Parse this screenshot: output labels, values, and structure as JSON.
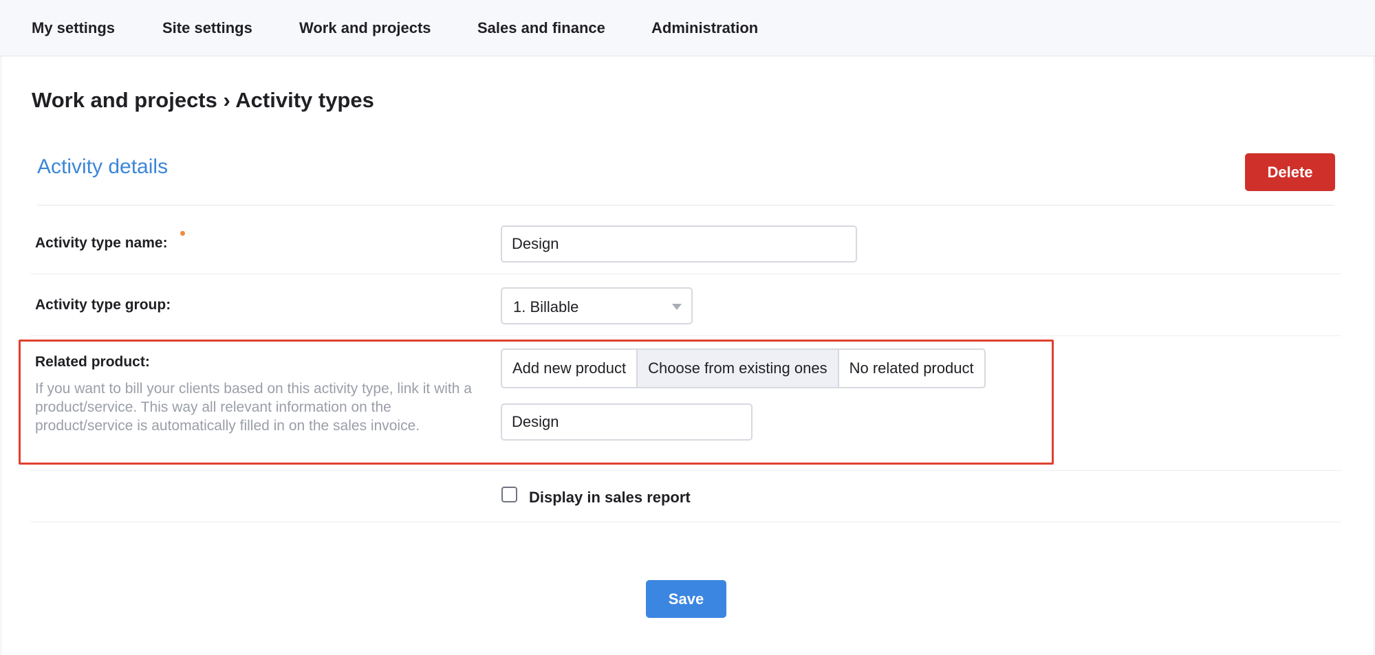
{
  "nav": {
    "items": [
      {
        "label": "My settings"
      },
      {
        "label": "Site settings"
      },
      {
        "label": "Work and projects"
      },
      {
        "label": "Sales and finance"
      },
      {
        "label": "Administration"
      }
    ]
  },
  "page": {
    "breadcrumb": "Work and projects › Activity types"
  },
  "section": {
    "title": "Activity details",
    "delete_label": "Delete"
  },
  "form": {
    "activity_type_name": {
      "label": "Activity type name:",
      "value": "Design"
    },
    "activity_type_group": {
      "label": "Activity type group:",
      "value": "1. Billable"
    },
    "related_product": {
      "label": "Related product:",
      "help": "If you want to bill your clients based on this activity type, link it with a product/service. This way all relevant information on the product/service is automatically filled in on the sales invoice.",
      "options": [
        {
          "label": "Add new product"
        },
        {
          "label": "Choose from existing ones"
        },
        {
          "label": "No related product"
        }
      ],
      "selected": "Choose from existing ones",
      "value": "Design"
    },
    "display_in_sales_report": {
      "label": "Display in sales report",
      "checked": false
    },
    "save_label": "Save"
  },
  "colors": {
    "accent": "#3b86d8",
    "danger": "#d0302a",
    "highlight": "#e0402f",
    "required": "#f08a3c"
  }
}
